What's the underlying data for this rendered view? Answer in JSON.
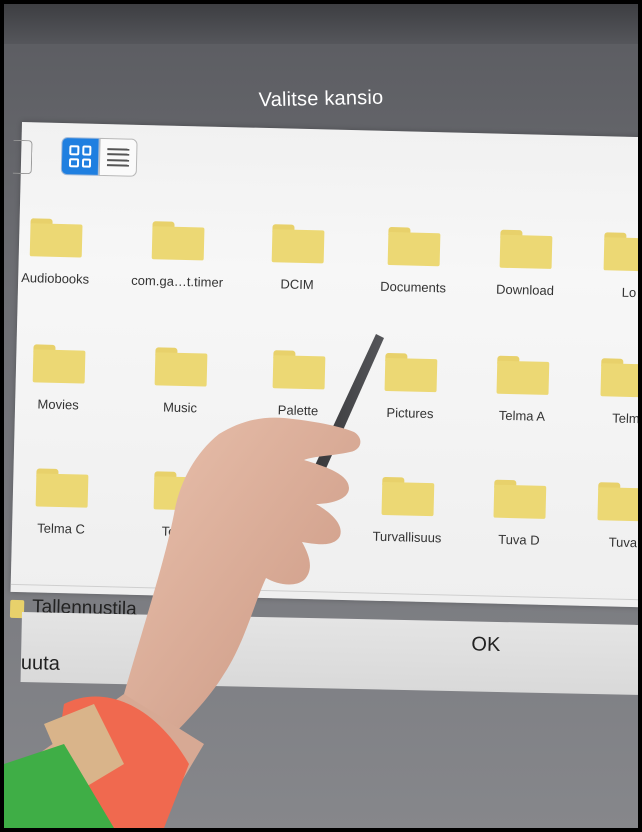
{
  "dialog": {
    "title": "Valitse kansio",
    "view_modes": {
      "grid_icon": "grid-view-icon",
      "list_icon": "list-view-icon",
      "active": "grid"
    },
    "folders": [
      {
        "name": "Audiobooks"
      },
      {
        "name": "com.ga…t.timer"
      },
      {
        "name": "DCIM"
      },
      {
        "name": "Documents"
      },
      {
        "name": "Download"
      },
      {
        "name": "Lo"
      },
      {
        "name": "Movies"
      },
      {
        "name": "Music"
      },
      {
        "name": "Palette"
      },
      {
        "name": "Pictures"
      },
      {
        "name": "Telma A"
      },
      {
        "name": "Telm"
      },
      {
        "name": "Telma C"
      },
      {
        "name": "Telma"
      },
      {
        "name": "Turvallisuus"
      },
      {
        "name": "Tuva D"
      },
      {
        "name": "Tuva"
      }
    ],
    "storage_label": "Tallennustila",
    "cancel_label": "uuta",
    "ok_label": "OK"
  },
  "colors": {
    "accent": "#1f7fe0",
    "folder": "#ecd874",
    "panel": "#f4f4f4",
    "watch_band": "#f0694f"
  }
}
